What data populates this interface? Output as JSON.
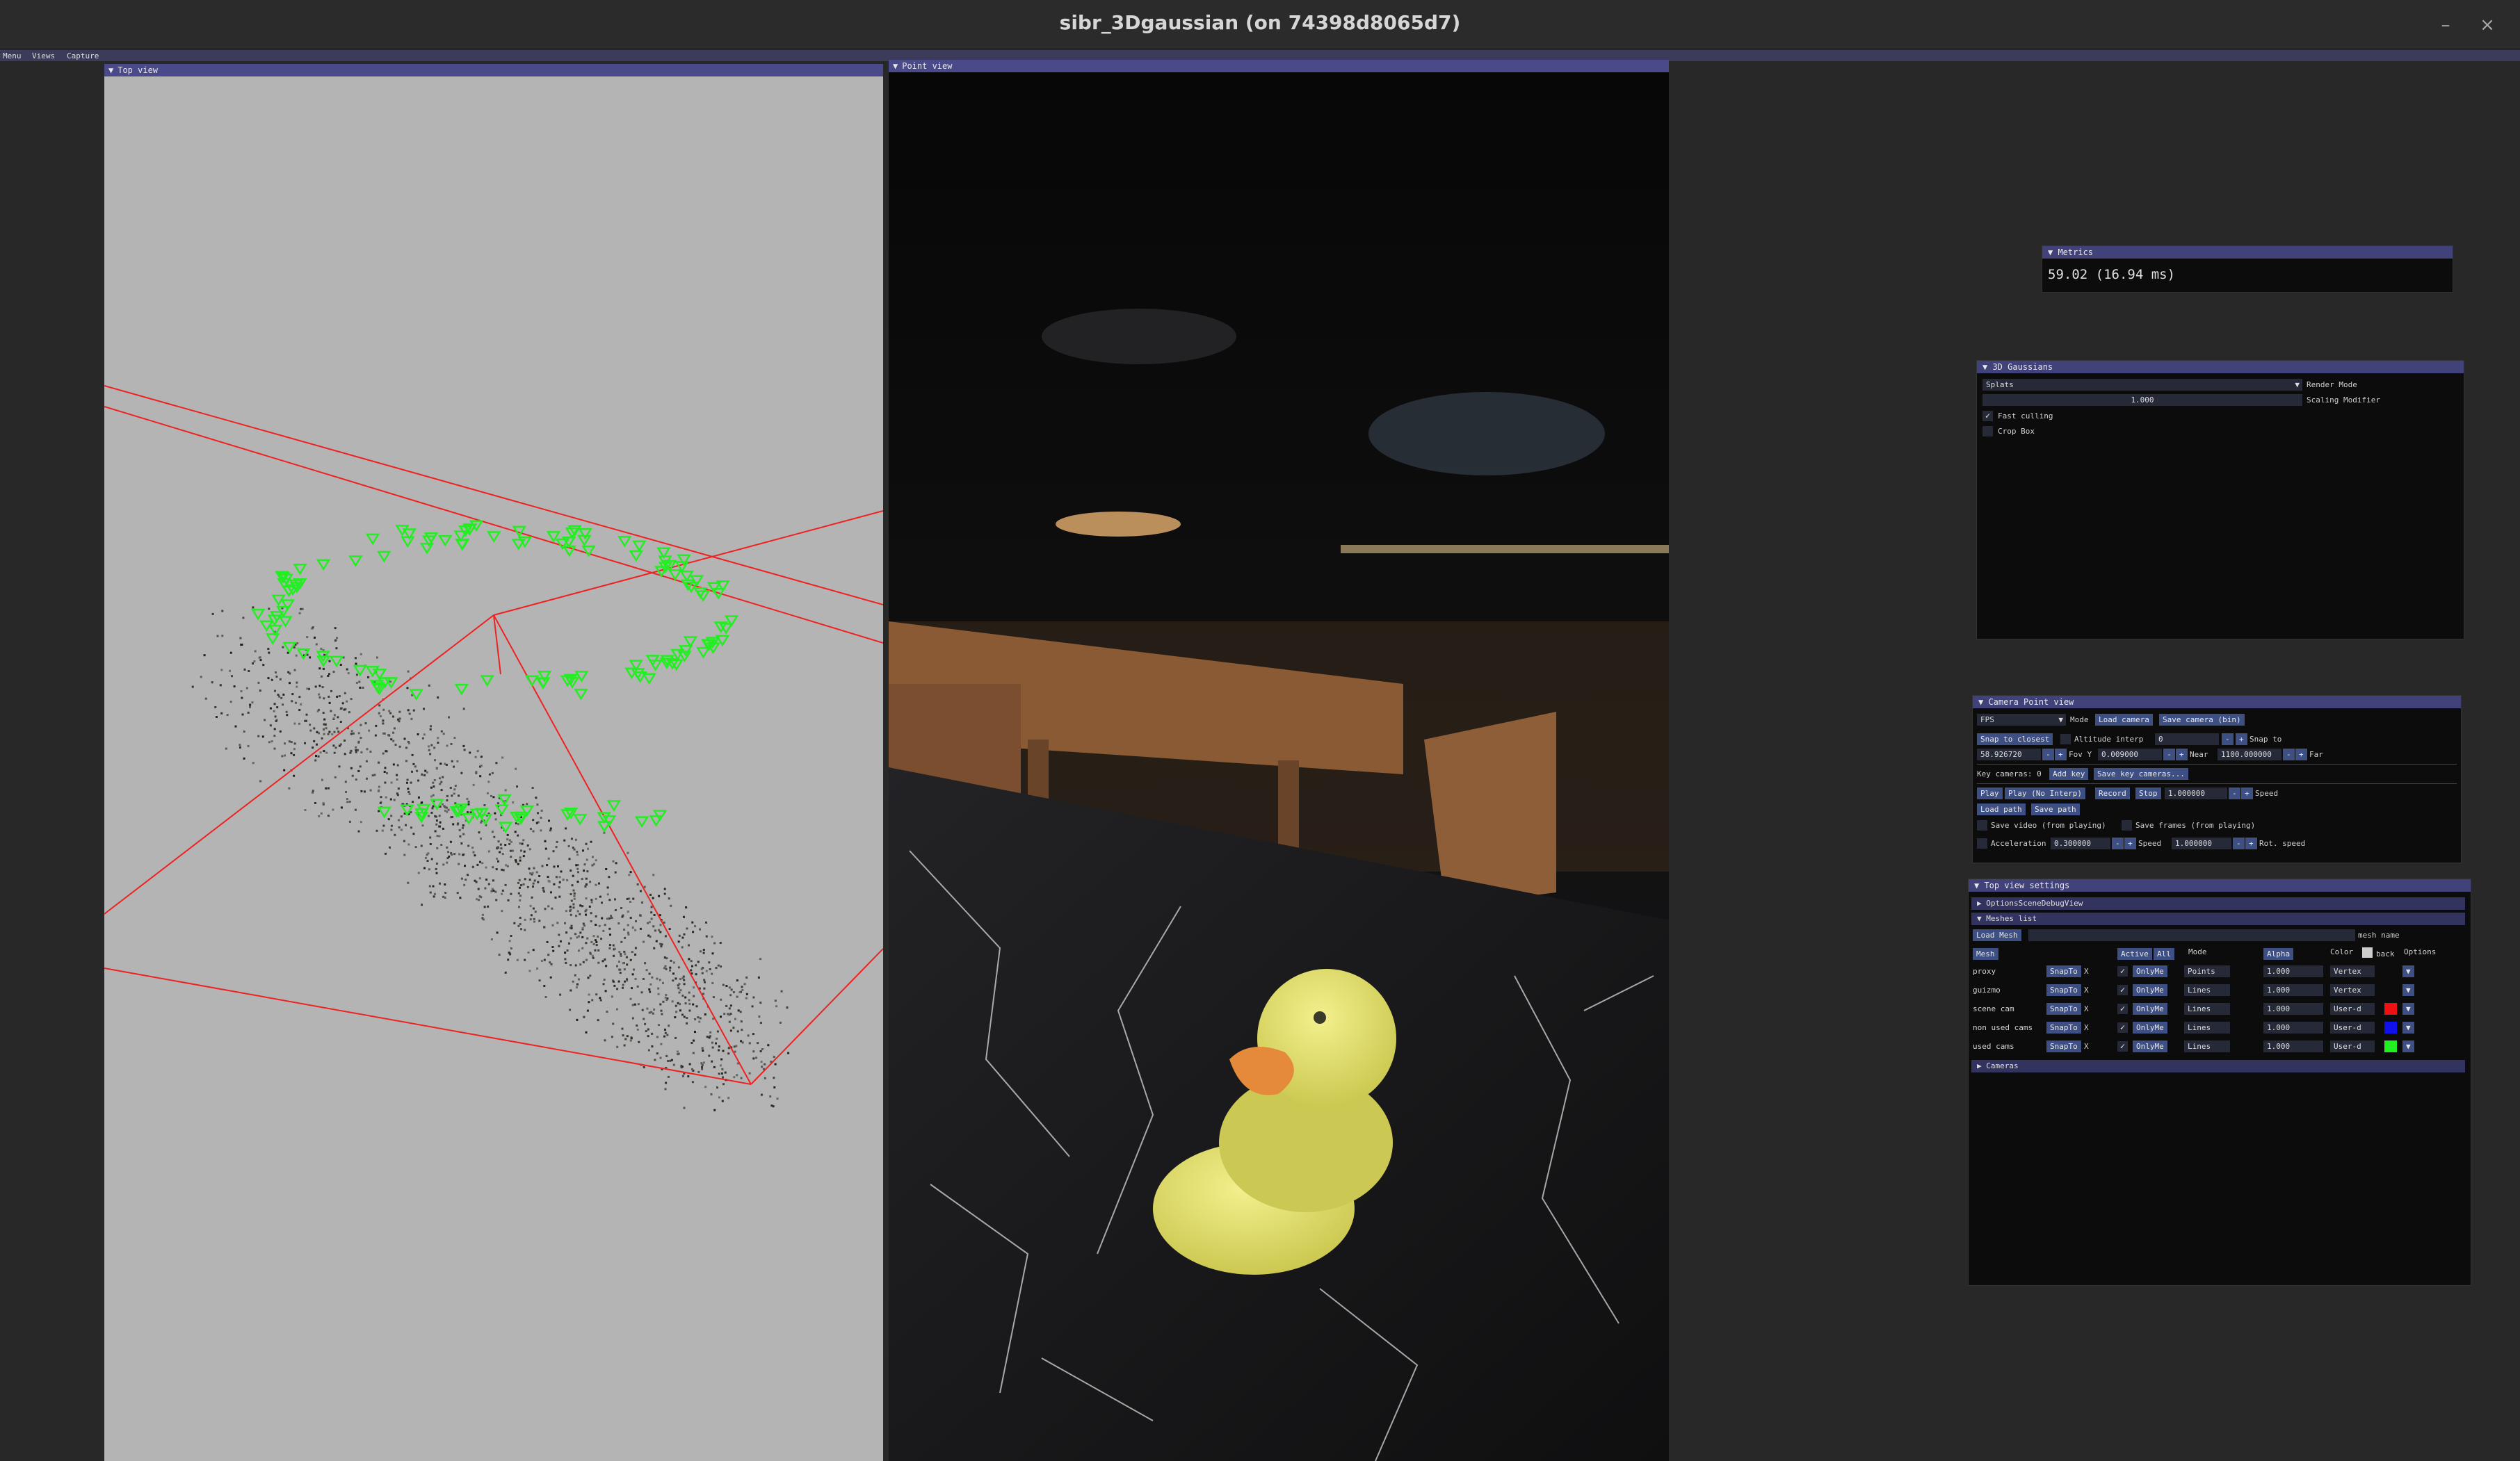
{
  "window": {
    "title": "sibr_3Dgaussian (on 74398d8065d7)",
    "min_icon": "minimize-icon",
    "close_icon": "close-icon",
    "min_glyph": "–",
    "close_glyph": "×"
  },
  "menubar": {
    "items": [
      "Menu",
      "Views",
      "Capture"
    ]
  },
  "top_view": {
    "title": "Top view",
    "bg": "#b4b4b4",
    "camera_color": "#22ee22",
    "frustum_color": "#ee2222"
  },
  "point_view": {
    "title": "Point view"
  },
  "metrics": {
    "title": "Metrics",
    "value": "59.02 (16.94 ms)"
  },
  "gaussian": {
    "title": "3D Gaussians",
    "render_mode_value": "Splats",
    "render_mode_label": "Render Mode",
    "scaling_value": "1.000",
    "scaling_label": "Scaling Modifier",
    "fast_culling_label": "Fast culling",
    "fast_culling_checked": "✓",
    "crop_box_label": "Crop Box"
  },
  "camera": {
    "title": "Camera Point view",
    "mode_value": "FPS",
    "mode_label": "Mode",
    "load_camera": "Load camera",
    "save_camera": "Save camera (bin)",
    "snap_closest": "Snap to closest",
    "altitude_label": "Altitude interp",
    "altitude_value": "0",
    "snap_to": "Snap to",
    "fov_value": "58.926720",
    "fov_label": "Fov Y",
    "near_value": "0.009000",
    "near_label": "Near",
    "far_value": "1100.000000",
    "far_label": "Far",
    "key_cameras": "Key cameras: 0",
    "add_key": "Add key",
    "save_key": "Save key cameras...",
    "play": "Play",
    "play_no_interp": "Play (No Interp)",
    "record": "Record",
    "stop": "Stop",
    "speed_value": "1.000000",
    "speed_label": "Speed",
    "load_path": "Load path",
    "save_path": "Save path",
    "save_video": "Save video (from playing)",
    "save_frames": "Save frames (from playing)",
    "accel_label": "Acceleration",
    "accel_value": "0.300000",
    "speed2_label": "Speed",
    "speed2_value": "1.000000",
    "rot_speed_label": "Rot. speed",
    "minus": "-",
    "plus": "+",
    "dropdown": "▼"
  },
  "top_settings": {
    "title": "Top view settings",
    "options_header": "OptionsSceneDebugView",
    "meshes_header": "Meshes list",
    "load_mesh": "Load Mesh",
    "mesh_name_label": "mesh name",
    "col_mesh": "Mesh",
    "col_active": "Active",
    "col_all": "All",
    "col_mode": "Mode",
    "col_alpha": "Alpha",
    "col_color": "Color",
    "col_back": "back",
    "col_options": "Options",
    "cameras_header": "Cameras",
    "rows": [
      {
        "name": "proxy",
        "snap": "SnapTo",
        "x": "X",
        "check": "✓",
        "only": "OnlyMe",
        "mode": "Points",
        "alpha": "1.000",
        "shade": "Vertex",
        "color": ""
      },
      {
        "name": "guizmo",
        "snap": "SnapTo",
        "x": "X",
        "check": "✓",
        "only": "OnlyMe",
        "mode": "Lines",
        "alpha": "1.000",
        "shade": "Vertex",
        "color": ""
      },
      {
        "name": "scene cam",
        "snap": "SnapTo",
        "x": "X",
        "check": "✓",
        "only": "OnlyMe",
        "mode": "Lines",
        "alpha": "1.000",
        "shade": "User-d",
        "color": "#ee1111"
      },
      {
        "name": "non used cams",
        "snap": "SnapTo",
        "x": "X",
        "check": "✓",
        "only": "OnlyMe",
        "mode": "Lines",
        "alpha": "1.000",
        "shade": "User-d",
        "color": "#1111ee"
      },
      {
        "name": "used cams",
        "snap": "SnapTo",
        "x": "X",
        "check": "✓",
        "only": "OnlyMe",
        "mode": "Lines",
        "alpha": "1.000",
        "shade": "User-d",
        "color": "#22ee22"
      }
    ]
  }
}
